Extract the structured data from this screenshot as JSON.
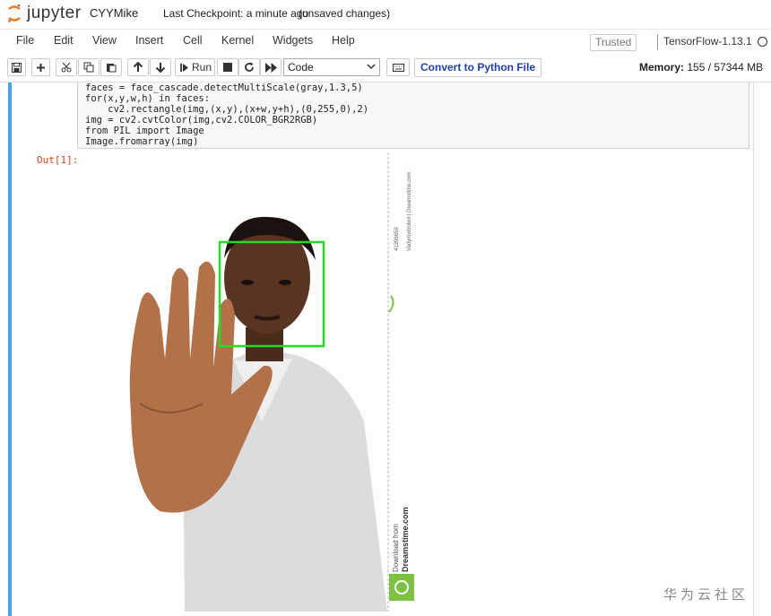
{
  "header": {
    "logo_text": "jupyter",
    "notebook_name": "CYYMike",
    "checkpoint": "Last Checkpoint: a minute ago",
    "unsaved": "(unsaved changes)"
  },
  "menu": {
    "items": [
      "File",
      "Edit",
      "View",
      "Insert",
      "Cell",
      "Kernel",
      "Widgets",
      "Help"
    ],
    "trusted": "Trusted",
    "kernel_name": "TensorFlow-1.13.1"
  },
  "toolbar": {
    "run_label": "Run",
    "cell_type": "Code",
    "convert_label": "Convert to Python File",
    "memory_label": "Memory:",
    "memory_value": "155 / 57344 MB"
  },
  "cell": {
    "code_lines": [
      "faces = face_cascade.detectMultiScale(gray,1.3,5)",
      "for(x,y,w,h) in faces:",
      "    cv2.rectangle(img,(x,y),(x+w,y+h),(0,255,0),2)",
      "img = cv2.cvtColor(img,cv2.COLOR_BGR2RGB)",
      "from PIL import Image",
      "Image.fromarray(img)"
    ],
    "out_prompt": "Out[1]:"
  },
  "image": {
    "side_text_1": "Download from",
    "side_text_2": "Dreamstime.com",
    "side_id": "41396659",
    "side_author": "Vadymvdrobot | Dreamstime.com"
  },
  "watermark": "华为云社区",
  "colors": {
    "cell_bar": "#42a5f5",
    "face_box": "#22dd22",
    "convert_text": "#1f3fae"
  }
}
